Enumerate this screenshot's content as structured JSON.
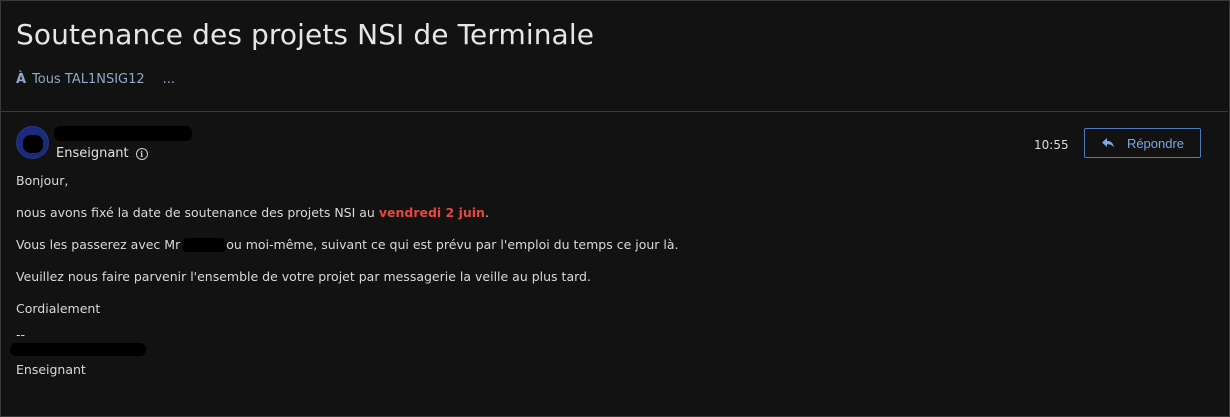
{
  "header": {
    "title": "Soutenance des projets NSI de Terminale",
    "recipients_prefix": "À",
    "recipients": "Tous TAL1NSIG12",
    "more": "..."
  },
  "message": {
    "sender_role": "Enseignant",
    "time": "10:55",
    "reply_label": "Répondre",
    "body": {
      "greeting": "Bonjour,",
      "line1_before": "nous avons fixé la date de soutenance des projets NSI au ",
      "line1_highlight": "vendredi 2 juin",
      "line1_after": ".",
      "line2_before": "Vous les passerez avec Mr",
      "line2_after": "ou moi-même, suivant ce qui est prévu par l'emploi du temps ce jour là.",
      "line3": "Veuillez nous faire parvenir l'ensemble de votre projet par messagerie la veille au plus tard.",
      "closing": "Cordialement",
      "sig_dashes": "--",
      "sig_role": "Enseignant"
    }
  },
  "colors": {
    "background": "#121212",
    "accent": "#7ea6e0",
    "highlight": "#e5493d"
  }
}
